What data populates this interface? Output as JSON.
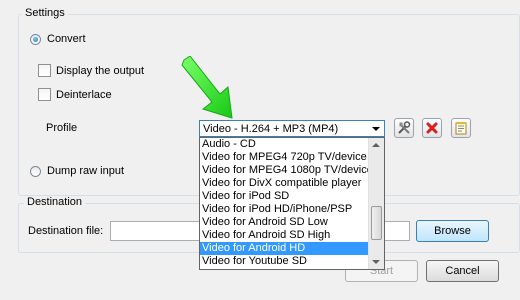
{
  "settings": {
    "group_label": "Settings",
    "convert_label": "Convert",
    "convert_selected": true,
    "display_output_label": "Display the output",
    "display_output_checked": false,
    "deinterlace_label": "Deinterlace",
    "deinterlace_checked": false,
    "profile_label": "Profile",
    "profile_value": "Video - H.264 + MP3 (MP4)",
    "dump_raw_label": "Dump raw input",
    "dump_raw_selected": false
  },
  "profile_dropdown": {
    "options": [
      "Audio - CD",
      "Video for MPEG4 720p TV/device",
      "Video for MPEG4 1080p TV/device",
      "Video for DivX compatible player",
      "Video for iPod SD",
      "Video for iPod HD/iPhone/PSP",
      "Video for Android SD Low",
      "Video for Android SD High",
      "Video for Android HD",
      "Video for Youtube SD"
    ],
    "highlighted_option": "Video for Android HD"
  },
  "destination": {
    "group_label": "Destination",
    "file_label": "Destination file:",
    "file_value": "",
    "browse_label": "Browse"
  },
  "footer": {
    "start_label": "Start",
    "cancel_label": "Cancel"
  },
  "icons": {
    "edit_profile": "wrench-screwdriver-icon",
    "delete_profile": "red-x-icon",
    "new_profile": "notepad-icon",
    "annotation": "green-arrow-icon"
  },
  "colors": {
    "highlight": "#3399ff",
    "delete_red": "#d81e1e",
    "arrow_green": "#22dd22"
  }
}
